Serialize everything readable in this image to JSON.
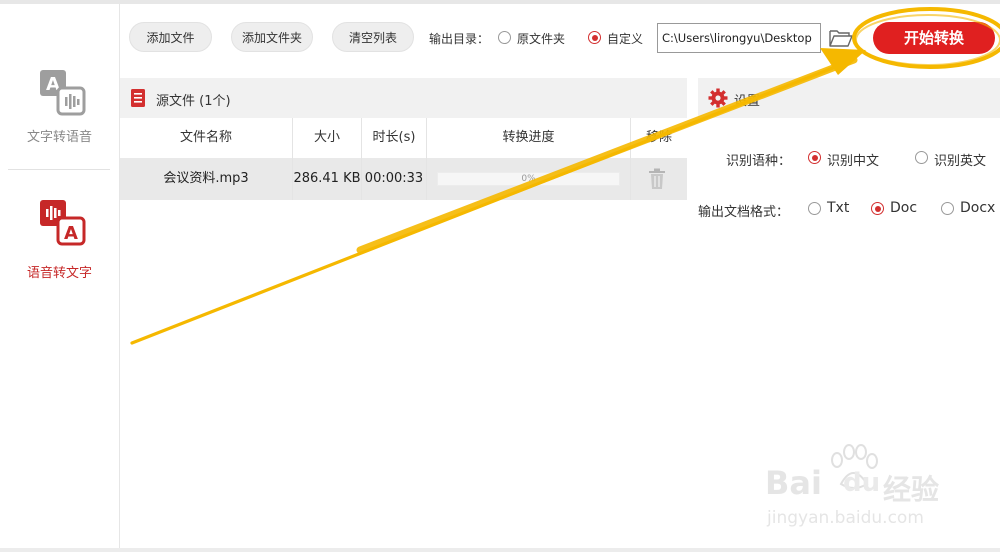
{
  "sidebar": {
    "items": [
      {
        "label": "文字转语音",
        "icon": "text-to-speech-icon",
        "active": false
      },
      {
        "label": "语音转文字",
        "icon": "speech-to-text-icon",
        "active": true
      }
    ]
  },
  "toolbar": {
    "add_file": "添加文件",
    "add_folder": "添加文件夹",
    "clear_list": "清空列表",
    "output_dir_label": "输出目录：",
    "output_options": [
      {
        "label": "原文件夹",
        "selected": false
      },
      {
        "label": "自定义",
        "selected": true
      }
    ],
    "output_path": "C:\\Users\\lirongyu\\Desktop",
    "start_label": "开始转换"
  },
  "files": {
    "title": "源文件 (1个)",
    "columns": [
      "文件名称",
      "大小",
      "时长(s)",
      "转换进度",
      "移除"
    ],
    "rows": [
      {
        "name": "会议资料.mp3",
        "size": "286.41 KB",
        "duration": "00:00:33",
        "progress_text": "0%"
      }
    ]
  },
  "settings": {
    "title": "设置",
    "language_label": "识别语种：",
    "language_options": [
      {
        "label": "识别中文",
        "selected": true
      },
      {
        "label": "识别英文",
        "selected": false
      }
    ],
    "format_label": "输出文档格式：",
    "format_options": [
      {
        "label": "Txt",
        "selected": false
      },
      {
        "label": "Doc",
        "selected": true
      },
      {
        "label": "Docx",
        "selected": false
      }
    ]
  },
  "watermark": {
    "brand": "Bai",
    "brand2": "du",
    "suffix": "经验",
    "url": "jingyan.baidu.com"
  },
  "colors": {
    "accent": "#e02020",
    "annotation": "#f5b800"
  }
}
